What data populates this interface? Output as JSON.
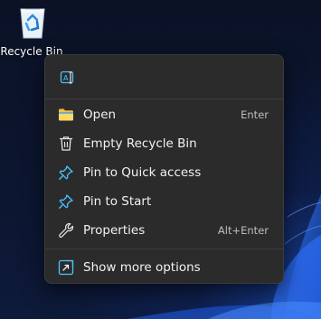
{
  "desktop": {
    "recycle_bin_label": "Recycle Bin"
  },
  "context_menu": {
    "quick_actions": [
      {
        "icon": "rename-icon"
      }
    ],
    "items": [
      {
        "label": "Open",
        "shortcut": "Enter",
        "icon": "folder-icon"
      },
      {
        "label": "Empty Recycle Bin",
        "shortcut": "",
        "icon": "trash-icon"
      },
      {
        "label": "Pin to Quick access",
        "shortcut": "",
        "icon": "pin-icon"
      },
      {
        "label": "Pin to Start",
        "shortcut": "",
        "icon": "pin-icon"
      },
      {
        "label": "Properties",
        "shortcut": "Alt+Enter",
        "icon": "wrench-icon"
      }
    ],
    "more": {
      "label": "Show more options",
      "icon": "show-more-icon"
    }
  },
  "colors": {
    "menu_bg": "#2b2b2b",
    "accent": "#4cc2ff",
    "text": "#f2f2f2",
    "shortcut_text": "#bdbdbd",
    "folder": "#f5c04a"
  }
}
